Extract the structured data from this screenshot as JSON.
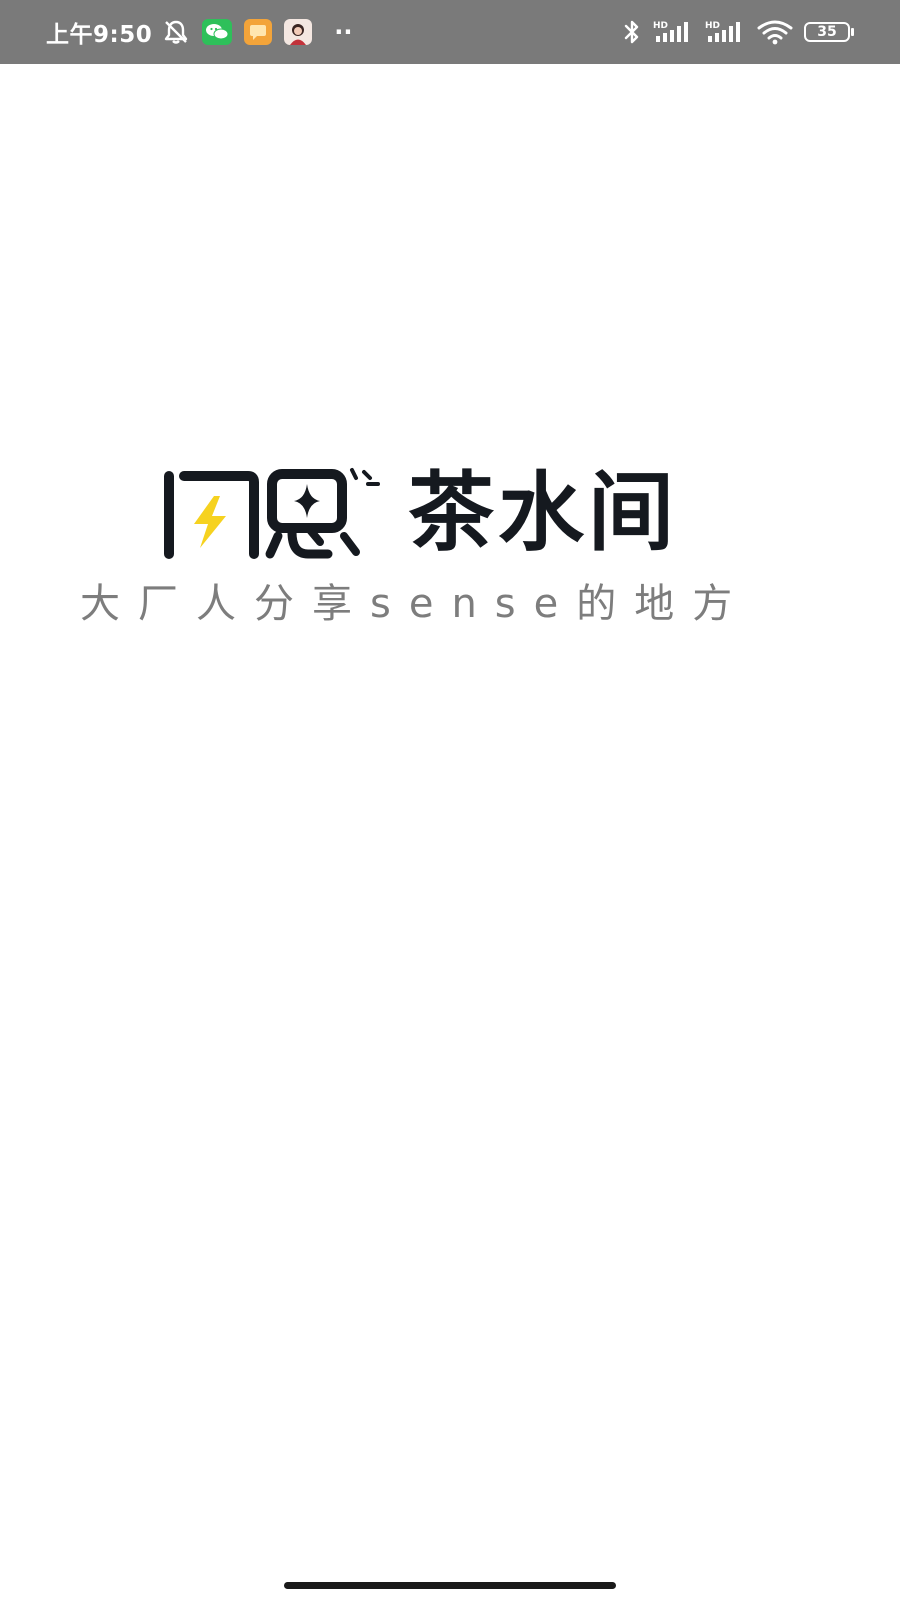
{
  "status_bar": {
    "time": "上午9:50",
    "overflow_dots": "··",
    "battery_level": "35",
    "icons": [
      "bell-off-icon",
      "wechat-icon",
      "message-app-icon",
      "avatar-app-icon",
      "bluetooth-icon",
      "hd-signal-icon",
      "hd-signal-icon",
      "wifi-icon",
      "battery-icon"
    ],
    "background_color": "#7a7a7a"
  },
  "splash": {
    "logo_text": "茶水间",
    "logo_mark_icon": "lightning-bolt-icon",
    "tagline": "大厂人分享sense的地方",
    "accent_color": "#f6d21f",
    "text_color": "#15191f",
    "tagline_color": "#7d7d7d"
  }
}
